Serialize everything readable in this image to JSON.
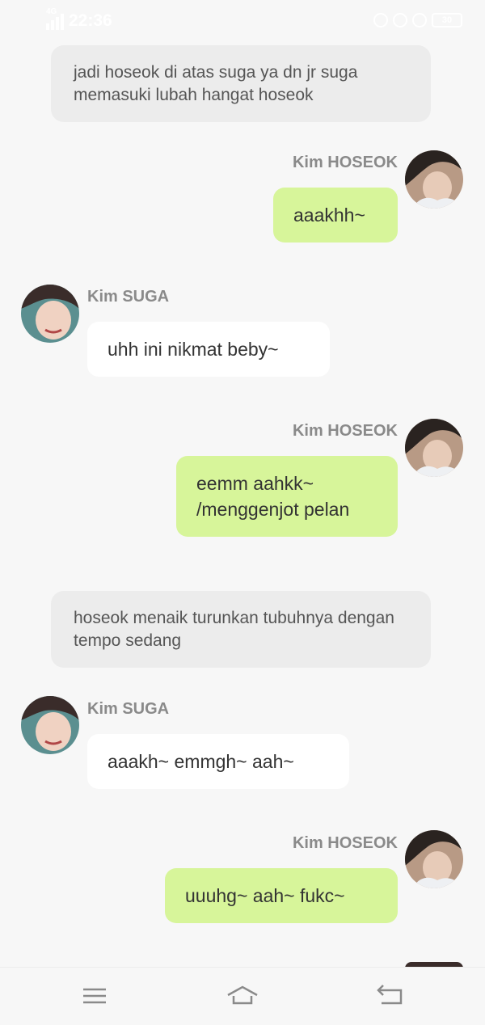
{
  "status_bar": {
    "network": "4G",
    "time": "22:36",
    "battery": "30"
  },
  "messages": [
    {
      "type": "narration",
      "text": "jadi hoseok di atas suga ya dn jr suga memasuki lubah hangat hoseok"
    },
    {
      "type": "outgoing",
      "sender": "Kim HOSEOK",
      "text": "aaakhh~"
    },
    {
      "type": "incoming",
      "sender": "Kim SUGA",
      "text": "uhh ini nikmat beby~"
    },
    {
      "type": "outgoing",
      "sender": "Kim HOSEOK",
      "text": "eemm aahkk~ /menggenjot pelan"
    },
    {
      "type": "narration",
      "text": "hoseok menaik turunkan tubuhnya dengan tempo sedang"
    },
    {
      "type": "incoming",
      "sender": "Kim SUGA",
      "text": "aaakh~ emmgh~ aah~"
    },
    {
      "type": "outgoing",
      "sender": "Kim HOSEOK",
      "text": "uuuhg~ aah~ fukc~"
    }
  ],
  "nav": {
    "menu_icon": "menu-icon",
    "home_icon": "home-icon",
    "back_icon": "back-icon"
  },
  "colors": {
    "outgoing_bubble": "#d7f59a",
    "incoming_bubble": "#ffffff",
    "narration_bubble": "#ececec",
    "background": "#f7f7f7"
  }
}
